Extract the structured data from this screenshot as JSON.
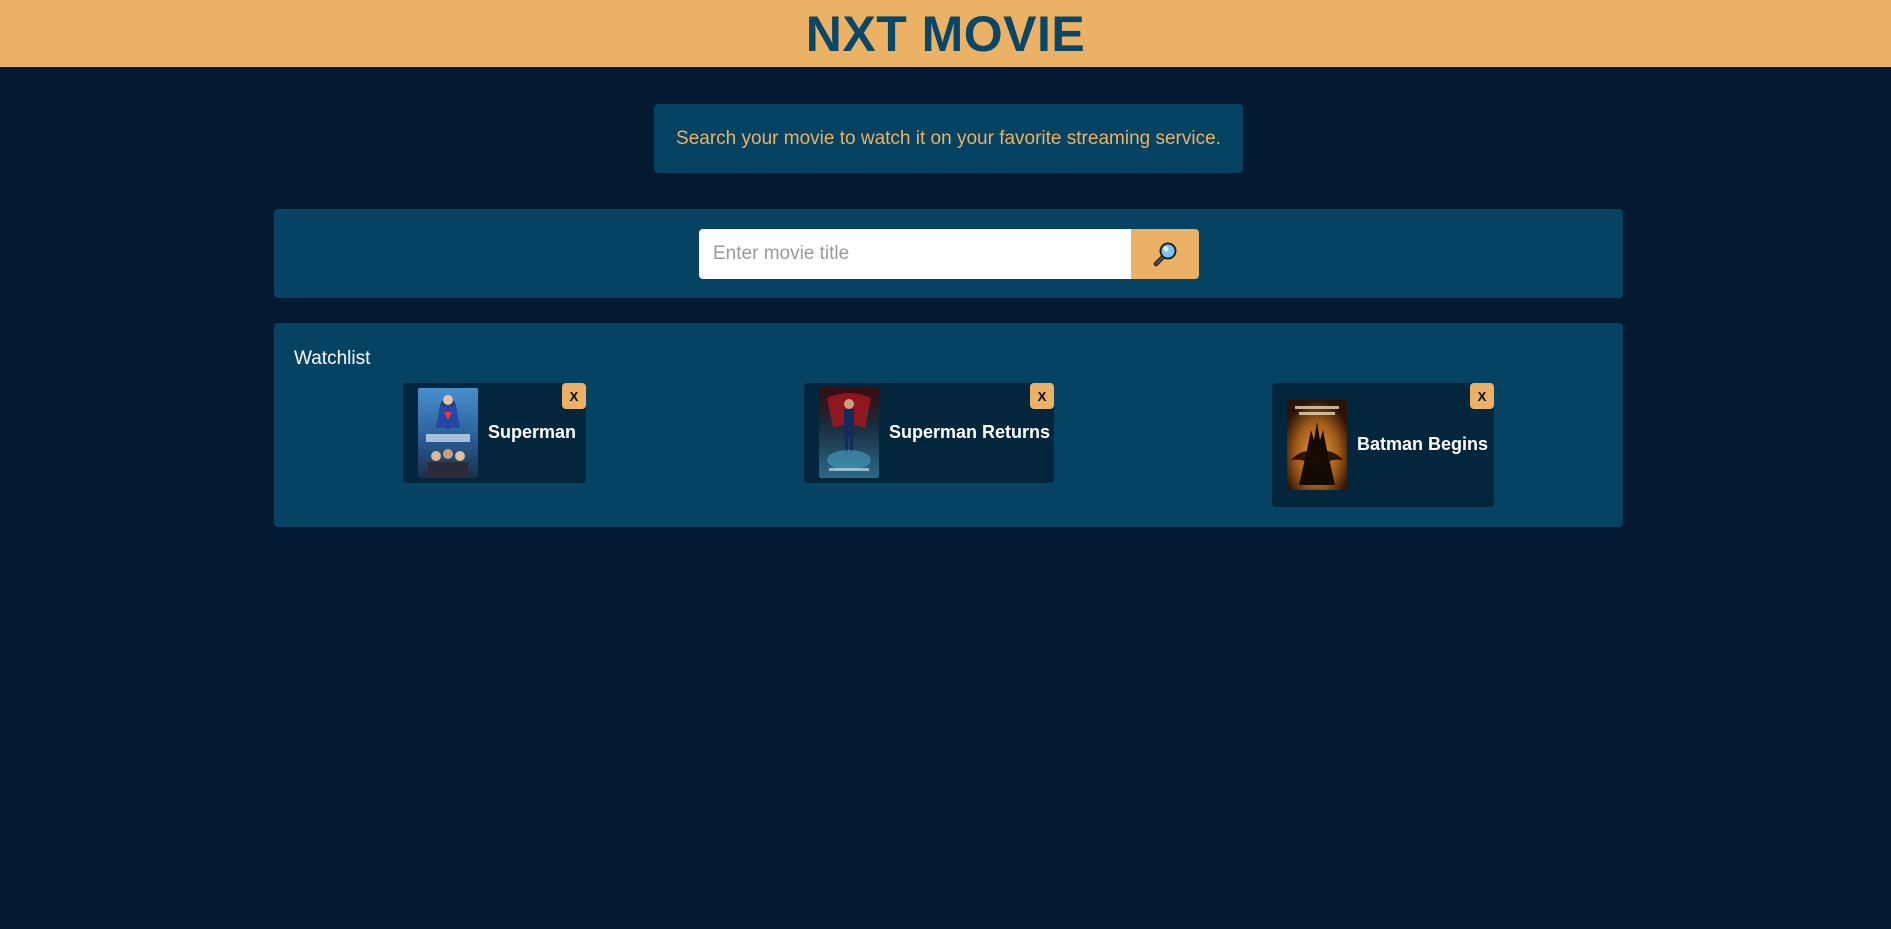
{
  "header": {
    "brand": "NXT MOVIE"
  },
  "intro": {
    "text": "Search your movie to watch it on your favorite streaming service."
  },
  "search": {
    "placeholder": "Enter movie title",
    "value": "",
    "button_icon": "magnifying-glass-icon"
  },
  "watchlist": {
    "title": "Watchlist",
    "items": [
      {
        "title": "Superman",
        "remove_label": "X"
      },
      {
        "title": "Superman Returns",
        "remove_label": "X"
      },
      {
        "title": "Batman Begins",
        "remove_label": "X"
      }
    ]
  },
  "colors": {
    "background": "#031a31",
    "header": "#ebb265",
    "brand_text": "#0a4766",
    "panel": "#064363",
    "card": "#03263d",
    "accent": "#ebb265"
  }
}
